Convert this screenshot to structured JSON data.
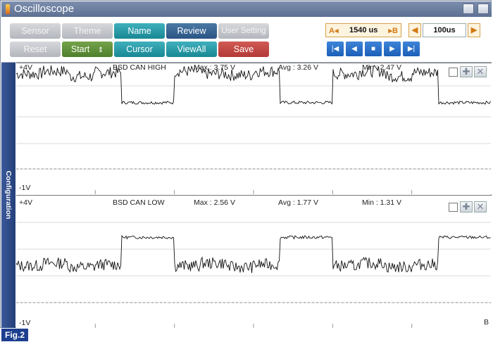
{
  "window": {
    "title": "Oscilloscope"
  },
  "toolbar": {
    "row1": [
      "Sensor",
      "Theme",
      "Name",
      "Review",
      "User Setting"
    ],
    "row2": [
      "Reset",
      "Start",
      "Cursor",
      "ViewAll",
      "Save"
    ],
    "start_arrows": "⇕",
    "time_a_label": "A◂",
    "time_value": "1540 us",
    "time_b_label": "▸B",
    "timebase": "100us"
  },
  "sidebar": {
    "label": "Configuration"
  },
  "channels": [
    {
      "name": "BSD CAN HIGH",
      "top_label": "+4V",
      "bottom_label": "-1V",
      "max": "Max : 3.75 V",
      "avg": "Avg : 3.26 V",
      "min": "Min : 2.47 V"
    },
    {
      "name": "BSD CAN LOW",
      "top_label": "+4V",
      "bottom_label": "-1V",
      "max": "Max : 2.56 V",
      "avg": "Avg : 1.77 V",
      "min": "Min : 1.31 V"
    }
  ],
  "chart_data": [
    {
      "type": "line",
      "series": [
        {
          "name": "BSD CAN HIGH",
          "values": [
            3.6,
            3.7,
            3.5,
            3.65,
            2.5,
            2.5,
            3.7,
            3.6,
            3.55,
            3.7,
            2.5,
            2.5,
            3.6,
            3.7,
            3.5,
            3.65,
            2.5,
            2.5
          ]
        }
      ],
      "ylim": [
        -1,
        4
      ]
    },
    {
      "type": "line",
      "series": [
        {
          "name": "BSD CAN LOW",
          "values": [
            1.4,
            1.5,
            1.35,
            1.45,
            2.5,
            2.5,
            1.4,
            1.5,
            1.35,
            1.45,
            2.5,
            2.5,
            1.4,
            1.5,
            1.35,
            1.45,
            2.5,
            2.5
          ]
        }
      ],
      "ylim": [
        -1,
        4
      ]
    }
  ],
  "corner_marker": "B",
  "figure_label": "Fig.2",
  "colors": {
    "title_bar": "#6a7c9e",
    "teal": "#2a9ba8",
    "navy": "#3a6694",
    "green": "#5d8f38",
    "red": "#c24743",
    "nav": "#2c72c9"
  }
}
